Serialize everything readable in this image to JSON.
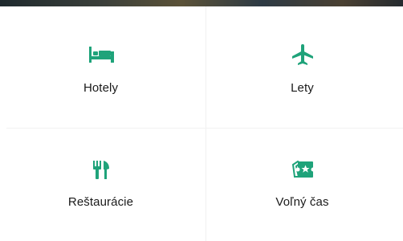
{
  "accent_color": "#1fa37a",
  "tiles": [
    {
      "label": "Hotely",
      "icon": "bed-icon"
    },
    {
      "label": "Lety",
      "icon": "airplane-icon"
    },
    {
      "label": "Reštaurácie",
      "icon": "fork-knife-icon"
    },
    {
      "label": "Voľný čas",
      "icon": "ticket-icon"
    }
  ]
}
